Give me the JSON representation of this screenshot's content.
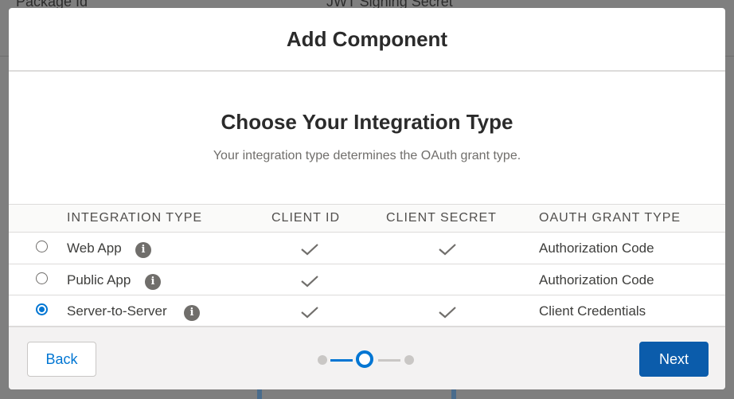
{
  "background": {
    "col1": "Package Id",
    "col2": "JWT Signing Secret"
  },
  "modal": {
    "title": "Add Component",
    "section_title": "Choose Your Integration Type",
    "section_subtitle": "Your integration type determines the OAuth grant type.",
    "table": {
      "headers": [
        "INTEGRATION TYPE",
        "CLIENT ID",
        "CLIENT SECRET",
        "OAUTH GRANT TYPE"
      ],
      "rows": [
        {
          "name": "Web App",
          "client_id": true,
          "client_secret": true,
          "grant": "Authorization Code",
          "selected": false
        },
        {
          "name": "Public App",
          "client_id": true,
          "client_secret": false,
          "grant": "Authorization Code",
          "selected": false
        },
        {
          "name": "Server-to-Server",
          "client_id": true,
          "client_secret": true,
          "grant": "Client Credentials",
          "selected": true
        }
      ],
      "icons": {
        "info": "info-icon",
        "check": "checkmark-icon"
      }
    },
    "footer": {
      "back_label": "Back",
      "next_label": "Next",
      "steps_total": 3,
      "current_step": 2
    }
  },
  "colors": {
    "accent": "#0176d3",
    "primary_button": "#0b5cab",
    "overlay": "#7f7f7f"
  }
}
